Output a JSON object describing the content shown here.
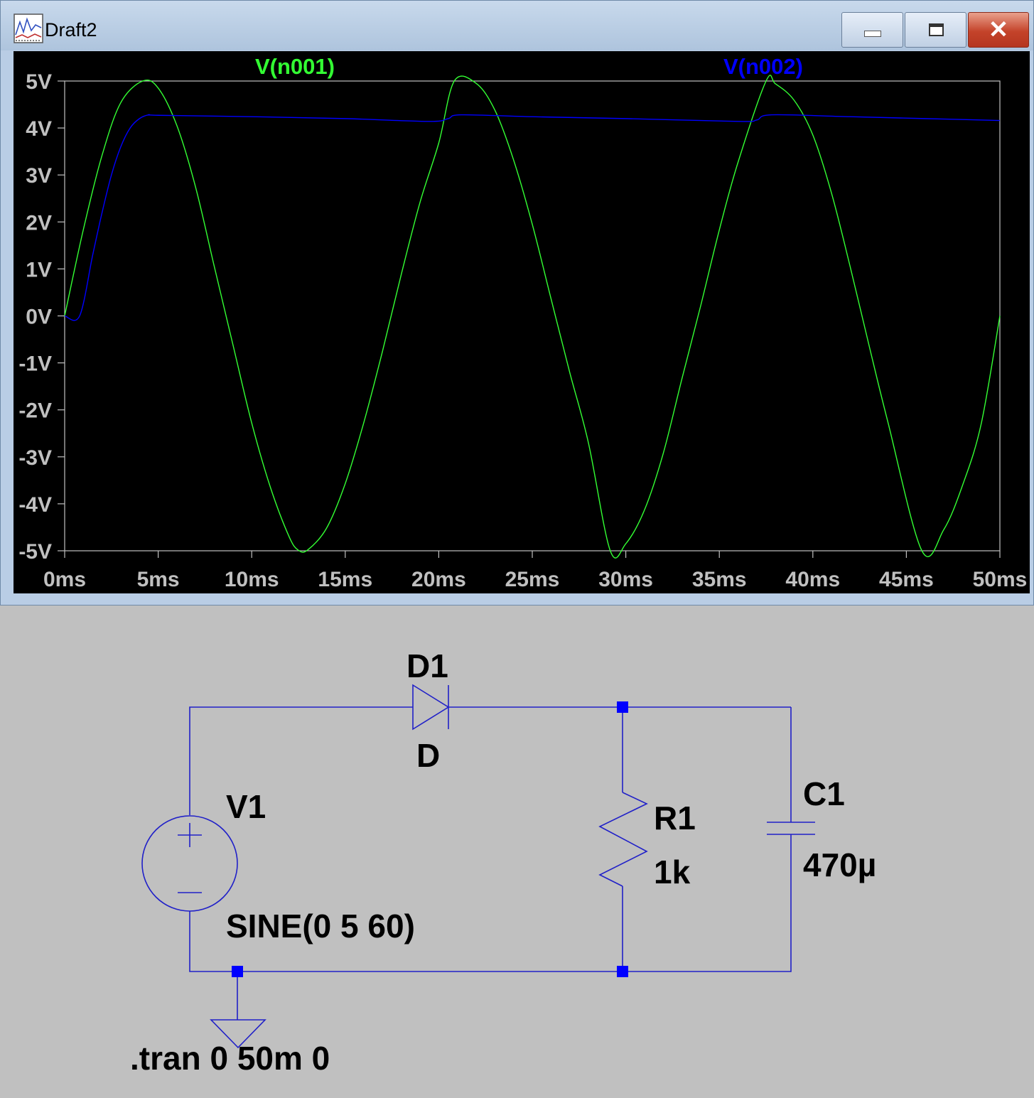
{
  "window": {
    "title": "Draft2",
    "icon": "waveform-viewer-icon",
    "controls": {
      "minimize": "minimize-icon",
      "maximize": "maximize-icon",
      "close": "close-icon"
    }
  },
  "plot": {
    "background": "#000000",
    "traces": [
      {
        "name": "V(n001)",
        "color": "#33ff33"
      },
      {
        "name": "V(n002)",
        "color": "#0000ff"
      }
    ]
  },
  "chart_data": {
    "type": "line",
    "xlim": [
      0,
      50
    ],
    "ylim": [
      -5,
      5
    ],
    "x_tick_labels": [
      "0ms",
      "5ms",
      "10ms",
      "15ms",
      "20ms",
      "25ms",
      "30ms",
      "35ms",
      "40ms",
      "45ms",
      "50ms"
    ],
    "y_tick_labels": [
      "5V",
      "4V",
      "3V",
      "2V",
      "1V",
      "0V",
      "-1V",
      "-2V",
      "-3V",
      "-4V",
      "-5V"
    ],
    "grid": false,
    "series": [
      {
        "name": "V(n001)",
        "color": "#33ff33",
        "x": [
          0,
          1,
          2,
          3,
          4.17,
          5,
          6,
          7,
          8,
          9,
          10,
          11,
          12,
          12.5,
          13,
          14,
          15,
          16,
          17,
          18,
          19,
          20,
          20.83,
          22,
          23,
          24,
          25,
          26,
          27,
          28,
          29.17,
          30,
          31,
          32,
          33,
          34,
          35,
          36,
          37.5,
          38,
          39,
          40,
          41,
          42,
          43,
          44,
          45.83,
          47,
          48,
          49,
          50
        ],
        "y": [
          0,
          1.84,
          3.42,
          4.54,
          5,
          4.85,
          4.05,
          2.74,
          1.05,
          -0.62,
          -2.28,
          -3.65,
          -4.7,
          -4.99,
          -4.98,
          -4.52,
          -3.57,
          -2.26,
          -0.74,
          0.89,
          2.42,
          3.68,
          5,
          4.95,
          4.38,
          3.32,
          1.95,
          0.37,
          -1.2,
          -2.7,
          -5,
          -4.85,
          -4.13,
          -2.93,
          -1.34,
          0.21,
          1.83,
          3.27,
          5,
          4.94,
          4.59,
          3.85,
          2.61,
          1.04,
          -0.62,
          -2.24,
          -5,
          -4.55,
          -3.61,
          -2.3,
          0
        ]
      },
      {
        "name": "V(n002)",
        "color": "#0000ff",
        "x": [
          0,
          0.8,
          1.5,
          2,
          2.5,
          3,
          3.5,
          4,
          4.5,
          5,
          10,
          15,
          19.5,
          20.5,
          21.2,
          25,
          30,
          36,
          37,
          37.8,
          42,
          46,
          50
        ],
        "y": [
          0,
          0,
          1.3,
          2.2,
          3.0,
          3.6,
          4.0,
          4.2,
          4.28,
          4.27,
          4.24,
          4.2,
          4.14,
          4.2,
          4.28,
          4.24,
          4.2,
          4.14,
          4.17,
          4.28,
          4.24,
          4.2,
          4.16
        ]
      }
    ]
  },
  "schematic": {
    "wire_color": "#2020c8",
    "junction_color": "#0000ff",
    "components": {
      "diode": {
        "ref": "D1",
        "value": "D"
      },
      "source": {
        "ref": "V1",
        "value": "SINE(0 5 60)"
      },
      "resistor": {
        "ref": "R1",
        "value": "1k"
      },
      "capacitor": {
        "ref": "C1",
        "value": "470µ"
      }
    },
    "directive": ".tran 0 50m 0"
  }
}
